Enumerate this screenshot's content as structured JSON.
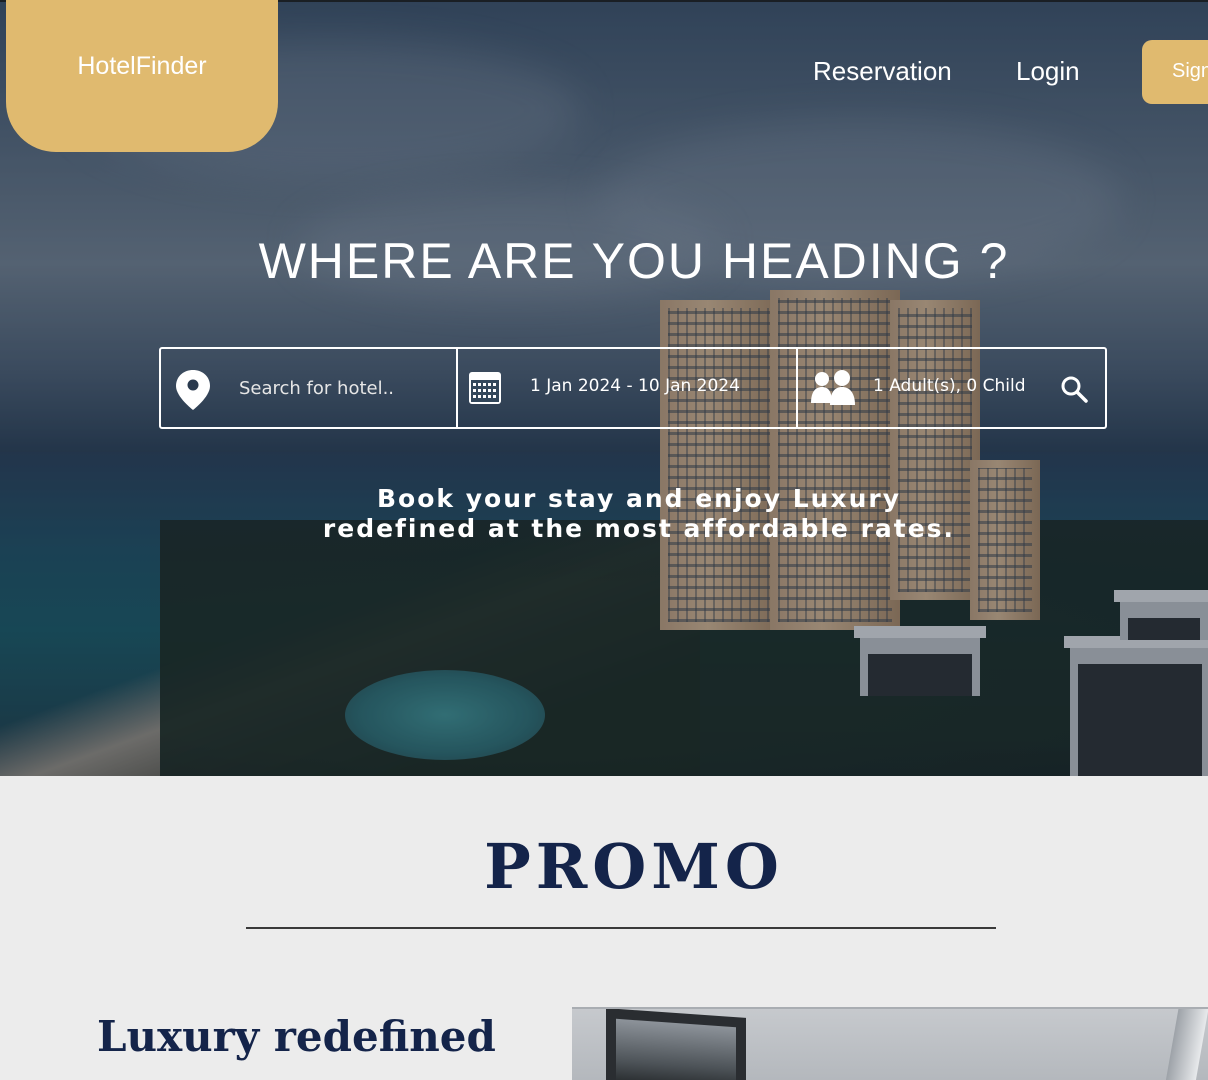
{
  "header": {
    "logo": "HotelFinder",
    "nav": {
      "reservation": "Reservation",
      "login": "Login",
      "signup": "Sign"
    }
  },
  "hero": {
    "heading": "WHERE ARE YOU HEADING ?",
    "search": {
      "hotel_placeholder": "Search for hotel..",
      "dates": "1 Jan 2024 - 10 Jan 2024",
      "guests": "1 Adult(s), 0 Child"
    },
    "tagline_line1": "Book your stay and enjoy Luxury",
    "tagline_line2": "redefined at the most affordable rates."
  },
  "promo": {
    "title": "PROMO",
    "subtitle": "Luxury redefined"
  },
  "icons": {
    "location": "location-pin-icon",
    "calendar": "calendar-icon",
    "guests": "people-icon",
    "search": "search-icon"
  },
  "colors": {
    "accent": "#e0ba6f",
    "navy": "#14244a",
    "background": "#ececec"
  }
}
